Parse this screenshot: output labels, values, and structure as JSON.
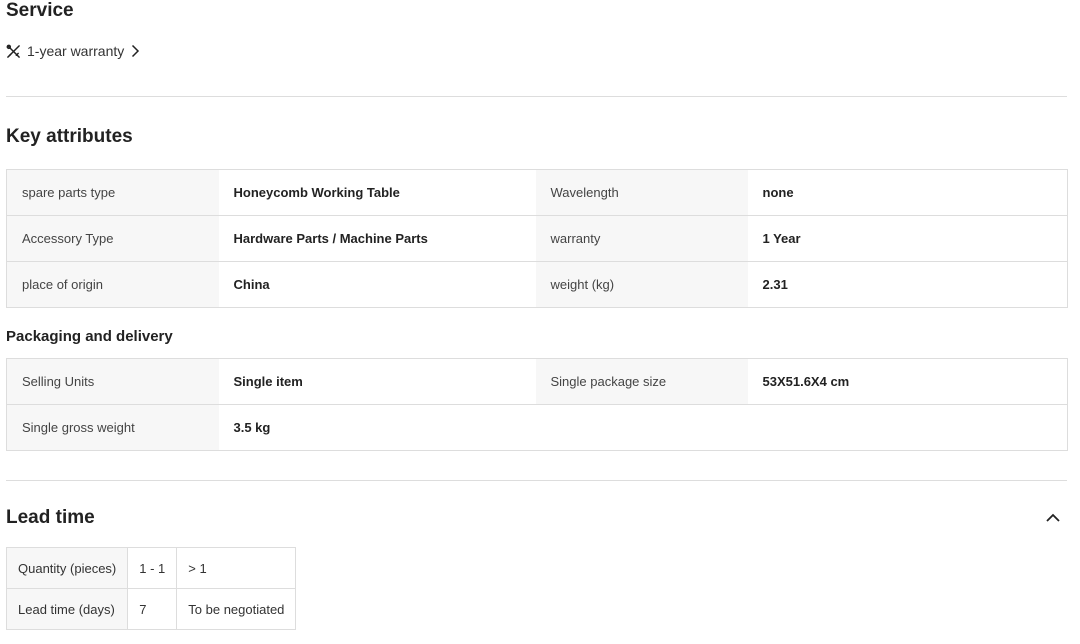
{
  "service": {
    "title": "Service",
    "warranty_link": "1-year warranty",
    "icon": "tools-icon"
  },
  "key_attributes": {
    "title": "Key attributes",
    "rows": [
      {
        "k1": "spare parts type",
        "v1": "Honeycomb Working Table",
        "k2": "Wavelength",
        "v2": "none"
      },
      {
        "k1": "Accessory Type",
        "v1": "Hardware Parts / Machine Parts",
        "k2": "warranty",
        "v2": "1 Year"
      },
      {
        "k1": "place of origin",
        "v1": "China",
        "k2": "weight (kg)",
        "v2": "2.31"
      }
    ]
  },
  "packaging": {
    "title": "Packaging and delivery",
    "rows": [
      {
        "k1": "Selling Units",
        "v1": "Single item",
        "k2": "Single package size",
        "v2": "53X51.6X4 cm"
      },
      {
        "k1": "Single gross weight",
        "v1": "3.5 kg"
      }
    ]
  },
  "lead_time": {
    "title": "Lead time",
    "header": [
      "Quantity (pieces)",
      "1 - 1",
      "> 1"
    ],
    "row": [
      "Lead time (days)",
      "7",
      "To be negotiated"
    ]
  }
}
